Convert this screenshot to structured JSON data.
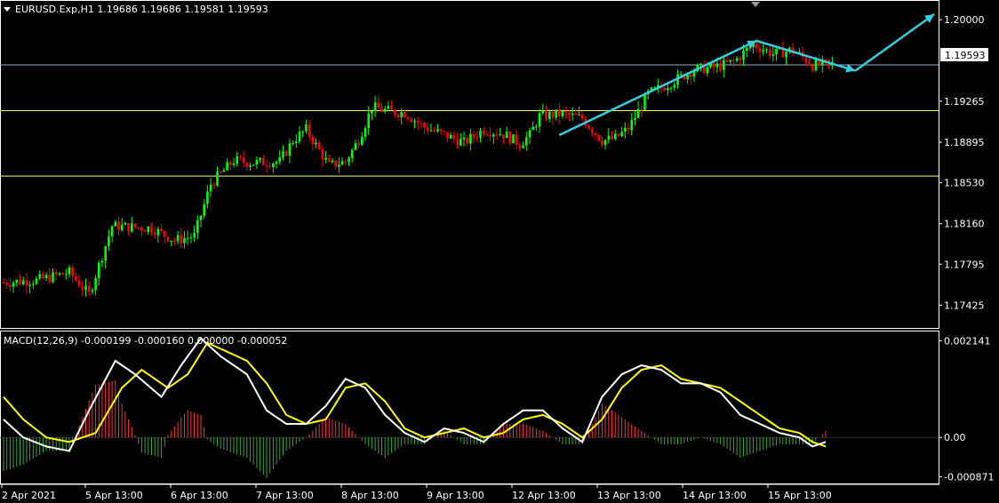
{
  "colors": {
    "background": "#000000",
    "frame": "#ffffff",
    "bull_candle": "#00ff00",
    "bear_candle": "#ff0000",
    "support_line": "#ffff66",
    "price_line": "#9ab0c8",
    "arrow": "#33cfe0",
    "macd_main": "#ffffff",
    "macd_signal": "#ffff00",
    "hist_up": "#ff3333",
    "hist_down": "#33aa33"
  },
  "chart_data": [
    {
      "type": "candlestick",
      "title": "EURUSD.Exp,H1  1.19686 1.19686 1.19581 1.19593",
      "current_price_label": "1.19593",
      "ylim": [
        1.1722,
        1.2017
      ],
      "y_ticks": [
        {
          "v": 1.2,
          "label": "1.20000"
        },
        {
          "v": 1.19265,
          "label": "1.19265"
        },
        {
          "v": 1.18895,
          "label": "1.18895"
        },
        {
          "v": 1.1853,
          "label": "1.18530"
        },
        {
          "v": 1.1816,
          "label": "1.18160"
        },
        {
          "v": 1.17795,
          "label": "1.17795"
        },
        {
          "v": 1.17425,
          "label": "1.17425"
        }
      ],
      "x_labels": [
        "2 Apr 2021",
        "5 Apr 13:00",
        "6 Apr 13:00",
        "7 Apr 13:00",
        "8 Apr 13:00",
        "9 Apr 13:00",
        "12 Apr 13:00",
        "13 Apr 13:00",
        "14 Apr 13:00",
        "15 Apr 13:00"
      ],
      "levels": [
        1.1918,
        1.1859
      ],
      "current_price": 1.19593,
      "price_path": [
        [
          0,
          1.1763
        ],
        [
          10,
          1.1765
        ],
        [
          20,
          1.1772
        ],
        [
          26,
          1.1752
        ],
        [
          33,
          1.1814
        ],
        [
          45,
          1.1812
        ],
        [
          52,
          1.1801
        ],
        [
          58,
          1.1805
        ],
        [
          63,
          1.1852
        ],
        [
          70,
          1.1873
        ],
        [
          75,
          1.1871
        ],
        [
          84,
          1.1872
        ],
        [
          88,
          1.1891
        ],
        [
          92,
          1.1901
        ],
        [
          96,
          1.1882
        ],
        [
          99,
          1.1868
        ],
        [
          101,
          1.187
        ],
        [
          104,
          1.1872
        ],
        [
          108,
          1.1892
        ],
        [
          112,
          1.1921
        ],
        [
          118,
          1.1917
        ],
        [
          122,
          1.1916
        ],
        [
          128,
          1.1903
        ],
        [
          135,
          1.1895
        ],
        [
          140,
          1.1889
        ],
        [
          146,
          1.1901
        ],
        [
          152,
          1.1897
        ],
        [
          157,
          1.1888
        ],
        [
          160,
          1.1896
        ],
        [
          163,
          1.1913
        ],
        [
          170,
          1.1915
        ],
        [
          176,
          1.1911
        ],
        [
          182,
          1.1891
        ],
        [
          186,
          1.1893
        ],
        [
          190,
          1.1902
        ],
        [
          196,
          1.1933
        ],
        [
          202,
          1.1942
        ],
        [
          210,
          1.1955
        ],
        [
          216,
          1.1957
        ],
        [
          222,
          1.1962
        ],
        [
          228,
          1.1978
        ],
        [
          234,
          1.1969
        ],
        [
          240,
          1.1973
        ],
        [
          246,
          1.1959
        ],
        [
          252,
          1.196
        ]
      ],
      "arrows": [
        {
          "from": [
            169,
            1.1896
          ],
          "to": [
            229,
            1.1981
          ]
        },
        {
          "from": [
            229,
            1.1981
          ],
          "to": [
            259,
            1.1954
          ]
        },
        {
          "from": [
            259,
            1.1954
          ],
          "to": [
            283,
            1.2005
          ]
        }
      ]
    },
    {
      "type": "line",
      "title": "MACD(12,26,9) -0.000199 -0.000160 0.000000 -0.000052",
      "ylim": [
        -0.00102,
        0.00235
      ],
      "y_ticks": [
        {
          "v": 0.002141,
          "label": "0.002141"
        },
        {
          "v": 0.0,
          "label": "0.00"
        },
        {
          "v": -0.000871,
          "label": "-0.000871"
        }
      ],
      "series": [
        {
          "name": "main",
          "points": [
            [
              0,
              0.0004
            ],
            [
              6,
              0.0
            ],
            [
              13,
              -0.0002
            ],
            [
              20,
              -0.0003
            ],
            [
              26,
              0.0006
            ],
            [
              34,
              0.0017
            ],
            [
              40,
              0.0014
            ],
            [
              48,
              0.0009
            ],
            [
              54,
              0.0016
            ],
            [
              60,
              0.0022
            ],
            [
              66,
              0.0018
            ],
            [
              74,
              0.0014
            ],
            [
              80,
              0.0006
            ],
            [
              86,
              0.0003
            ],
            [
              92,
              0.0003
            ],
            [
              98,
              0.0007
            ],
            [
              104,
              0.0013
            ],
            [
              110,
              0.0011
            ],
            [
              116,
              0.0005
            ],
            [
              122,
              0.0001
            ],
            [
              128,
              -0.0001
            ],
            [
              134,
              0.0002
            ],
            [
              140,
              0.0001
            ],
            [
              146,
              -0.0001
            ],
            [
              152,
              0.0003
            ],
            [
              158,
              0.0006
            ],
            [
              164,
              0.0006
            ],
            [
              170,
              0.0002
            ],
            [
              176,
              -0.0001
            ],
            [
              182,
              0.0009
            ],
            [
              188,
              0.0014
            ],
            [
              194,
              0.0016
            ],
            [
              200,
              0.0015
            ],
            [
              206,
              0.0012
            ],
            [
              212,
              0.0012
            ],
            [
              218,
              0.001
            ],
            [
              224,
              0.0005
            ],
            [
              230,
              0.0003
            ],
            [
              236,
              0.0001
            ],
            [
              242,
              0.0
            ],
            [
              246,
              -0.0002
            ],
            [
              250,
              -0.0001
            ]
          ]
        },
        {
          "name": "signal",
          "points": [
            [
              0,
              0.0009
            ],
            [
              6,
              0.0004
            ],
            [
              13,
              0.0
            ],
            [
              20,
              -0.0001
            ],
            [
              28,
              0.0001
            ],
            [
              36,
              0.0011
            ],
            [
              42,
              0.0015
            ],
            [
              50,
              0.0011
            ],
            [
              56,
              0.0014
            ],
            [
              62,
              0.0021
            ],
            [
              68,
              0.0019
            ],
            [
              74,
              0.0017
            ],
            [
              80,
              0.0012
            ],
            [
              86,
              0.0005
            ],
            [
              92,
              0.0003
            ],
            [
              98,
              0.0004
            ],
            [
              104,
              0.0011
            ],
            [
              110,
              0.0012
            ],
            [
              116,
              0.0008
            ],
            [
              122,
              0.0002
            ],
            [
              128,
              0.0
            ],
            [
              134,
              0.0001
            ],
            [
              140,
              0.0002
            ],
            [
              146,
              0.0
            ],
            [
              152,
              0.0001
            ],
            [
              158,
              0.0004
            ],
            [
              164,
              0.0005
            ],
            [
              170,
              0.0003
            ],
            [
              176,
              0.0
            ],
            [
              182,
              0.0004
            ],
            [
              188,
              0.0011
            ],
            [
              194,
              0.0015
            ],
            [
              200,
              0.0016
            ],
            [
              206,
              0.0013
            ],
            [
              212,
              0.0012
            ],
            [
              218,
              0.0011
            ],
            [
              224,
              0.0008
            ],
            [
              230,
              0.0005
            ],
            [
              236,
              0.0002
            ],
            [
              242,
              0.0001
            ],
            [
              246,
              -0.0001
            ],
            [
              250,
              -0.0002
            ]
          ]
        }
      ]
    }
  ]
}
